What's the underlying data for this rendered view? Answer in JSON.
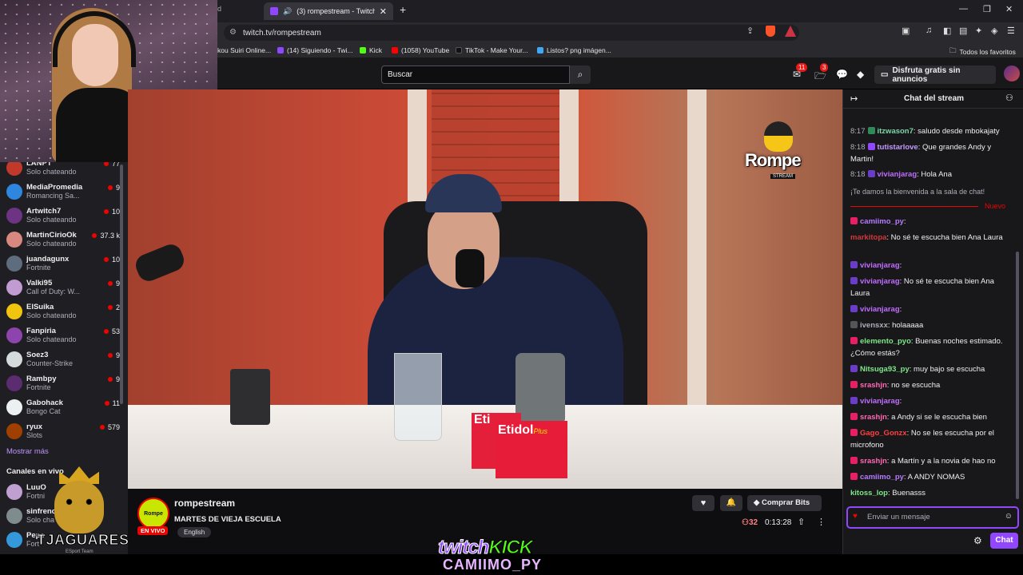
{
  "browser": {
    "prev_tab_fragment": "d",
    "active_tab_title": "(3) rompestream - Twitch",
    "url": "twitch.tv/rompestream",
    "bookmarks": [
      {
        "label": "kou Suiri Online...",
        "color": "#5a5a5a"
      },
      {
        "label": "(14) Siguiendo - Twi...",
        "color": "#9147ff"
      },
      {
        "label": "Kick",
        "color": "#53fc18"
      },
      {
        "label": "(1058) YouTube",
        "color": "#ff0000"
      },
      {
        "label": "TikTok - Make Your...",
        "color": "#111111"
      },
      {
        "label": "Listos? png imágen...",
        "color": "#3fa9f5"
      }
    ],
    "favorites_label": "Todos los favoritos",
    "shield_count": "17"
  },
  "topnav": {
    "search_placeholder": "Buscar",
    "inbox_badge": "11",
    "whisper_badge": "3",
    "turbo_label": "Disfruta gratis sin anuncios"
  },
  "sidebar": {
    "channels": [
      {
        "name": "LANPT",
        "game": "Solo chateando",
        "viewers": "77",
        "color": "#c0392b"
      },
      {
        "name": "MediaPromedia",
        "game": "Romancing Sa...",
        "viewers": "9",
        "color": "#2e86de"
      },
      {
        "name": "Artwitch7",
        "game": "Solo chateando",
        "viewers": "10",
        "color": "#6c3483"
      },
      {
        "name": "MartinCirioOk",
        "game": "Solo chateando",
        "viewers": "37.3 k",
        "color": "#d98880"
      },
      {
        "name": "juandagunx",
        "game": "Fortnite",
        "viewers": "10",
        "color": "#5d6d7e"
      },
      {
        "name": "Valki95",
        "game": "Call of Duty: W...",
        "viewers": "9",
        "color": "#c39bd3"
      },
      {
        "name": "ElSuika",
        "game": "Solo chateando",
        "viewers": "2",
        "color": "#f1c40f"
      },
      {
        "name": "Fanpiria",
        "game": "Solo chateando",
        "viewers": "53",
        "color": "#8e44ad"
      },
      {
        "name": "Soez3",
        "game": "Counter-Strike",
        "viewers": "9",
        "color": "#d5dbdb"
      },
      {
        "name": "Rambpy",
        "game": "Fortnite",
        "viewers": "9",
        "color": "#5b2c6f"
      },
      {
        "name": "Gabohack",
        "game": "Bongo Cat",
        "viewers": "11",
        "color": "#ecf0f1"
      },
      {
        "name": "ryux",
        "game": "Slots",
        "viewers": "579",
        "color": "#a04000"
      }
    ],
    "show_more": "Mostrar más",
    "live_header": "Canales en vivo",
    "live_channels": [
      {
        "name": "LuuO",
        "game": "Fortni",
        "color": "#c0a0d0"
      },
      {
        "name": "sinfreno",
        "game": "Solo cha",
        "color": "#7f8c8d"
      },
      {
        "name": "Pepe",
        "game": "Fort",
        "color": "#3498db"
      }
    ]
  },
  "webcam": {
    "desc_hidden": false
  },
  "video": {
    "logo_text": "Rompe",
    "logo_sub": "STREAM",
    "product_name": "Etidol",
    "product_suffix": "Plus",
    "product_small": "Eti"
  },
  "stream": {
    "avatar_text": "Rompe",
    "live_badge": "EN VIVO",
    "channel": "rompestream",
    "title": "MARTES DE VIEJA ESCUELA",
    "tag": "English",
    "bits_label": "Comprar Bits",
    "viewers": "32",
    "uptime": "0:13:28"
  },
  "chat": {
    "title": "Chat del stream",
    "messages": [
      {
        "time": "8:17",
        "user": "itzwason7",
        "color": "#7cd6a8",
        "badge": "#2e8b57",
        "text": ": saludo desde mbokajaty"
      },
      {
        "time": "8:18",
        "user": "tutistarlove",
        "color": "#c19bff",
        "badge": "#9147ff",
        "text": ": Que grandes Andy y Martin!"
      },
      {
        "time": "8:18",
        "user": "vivianjarag",
        "color": "#bf6cff",
        "badge": "#6a3cc8",
        "text": ": Hola Ana"
      }
    ],
    "welcome": "¡Te damos la bienvenida a la sala de chat!",
    "new_label": "Nuevo",
    "messages2": [
      {
        "user": "camiimo_py",
        "color": "#b47cff",
        "badge": "#e91e63",
        "text": ":"
      },
      {
        "user": "markitopa",
        "color": "#d2383c",
        "badge": "",
        "text": ": No sé te escucha bien Ana Laura"
      },
      {
        "user": "vivianjarag",
        "color": "#bf6cff",
        "badge": "#6a3cc8",
        "text": ":"
      },
      {
        "user": "vivianjarag",
        "color": "#bf6cff",
        "badge": "#6a3cc8",
        "text": ": No sé te escucha bien Ana Laura"
      },
      {
        "user": "vivianjarag",
        "color": "#bf6cff",
        "badge": "#6a3cc8",
        "text": ":"
      },
      {
        "user": "ivensxx",
        "color": "#adadb8",
        "badge": "#555555",
        "text": ": holaaaaa"
      },
      {
        "user": "elemento_pyo",
        "color": "#7ee787",
        "badge": "#e91e63",
        "text": ": Buenas noches estimado. ¿Cómo estás?"
      },
      {
        "user": "Nitsuga93_py",
        "color": "#7ee787",
        "badge": "#6a3cc8",
        "text": ": muy bajo se escucha"
      },
      {
        "user": "srashjn",
        "color": "#ff69b4",
        "badge": "#e91e63",
        "text": ": no se escucha"
      },
      {
        "user": "vivianjarag",
        "color": "#bf6cff",
        "badge": "#6a3cc8",
        "text": ":"
      },
      {
        "user": "srashjn",
        "color": "#ff69b4",
        "badge": "#e91e63",
        "text": ": a Andy si se le escucha bien"
      },
      {
        "user": "Gago_Gonzx",
        "color": "#ff4040",
        "badge": "#e91e63",
        "text": ": No se les escucha por el microfono"
      },
      {
        "user": "srashjn",
        "color": "#ff69b4",
        "badge": "#e91e63",
        "text": ": a Martín y a la novia de hao no"
      },
      {
        "user": "camiimo_py",
        "color": "#b47cff",
        "badge": "#e91e63",
        "text": ": A ANDY NOMAS"
      },
      {
        "user": "kitoss_lop",
        "color": "#7ee787",
        "badge": "",
        "text": ": Buenasss"
      }
    ],
    "input_placeholder": "Enviar un mensaje",
    "send_label": "Chat"
  },
  "overlay": {
    "brand_twitch": "twitch",
    "brand_kick": "KICK",
    "handle": "CAMIIMO_PY",
    "team_name": "TJAGUARES",
    "team_sub": "ESport Team"
  }
}
